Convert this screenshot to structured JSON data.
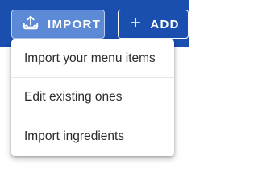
{
  "toolbar": {
    "import_label": "IMPORT",
    "add_label": "ADD",
    "add_glyph": "+",
    "import_icon": "upload-tray-icon",
    "add_icon": "plus-icon"
  },
  "import_menu": {
    "items": [
      {
        "label": "Import your menu items"
      },
      {
        "label": "Edit existing ones"
      },
      {
        "label": "Import ingredients"
      }
    ]
  },
  "colors": {
    "header_blue": "#1a4fb0",
    "import_button": "#5c8ad6",
    "text": "#2b2b2b"
  }
}
